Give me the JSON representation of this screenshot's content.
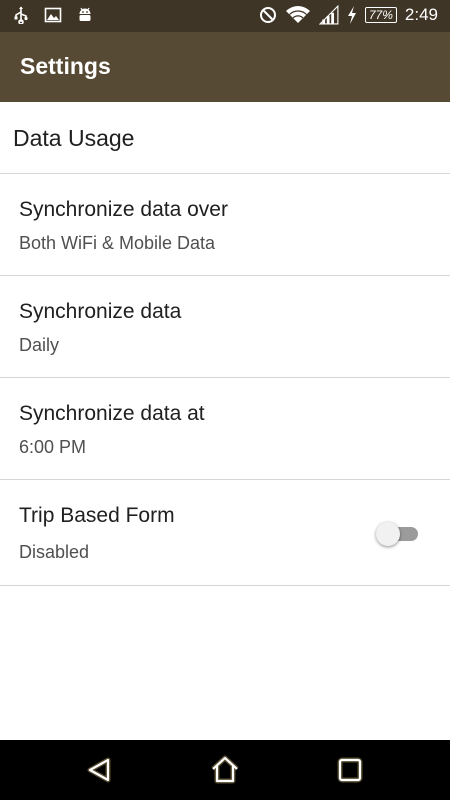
{
  "status_bar": {
    "left_icons": [
      "usb-icon",
      "image-icon",
      "android-icon"
    ],
    "right_icons": [
      "do-not-disturb-icon",
      "wifi-icon",
      "signal-icon",
      "charging-icon"
    ],
    "battery": "77%",
    "time": "2:49"
  },
  "app_bar": {
    "title": "Settings",
    "color": "#574a34"
  },
  "section": {
    "title": "Data Usage"
  },
  "preferences": [
    {
      "title": "Synchronize data over",
      "summary": "Both WiFi & Mobile Data"
    },
    {
      "title": "Synchronize data",
      "summary": "Daily"
    },
    {
      "title": "Synchronize data at",
      "summary": "6:00 PM"
    },
    {
      "title": "Trip Based Form",
      "summary": "Disabled",
      "toggle_on": false
    }
  ],
  "nav_bar": {
    "buttons": [
      "back-icon",
      "home-icon",
      "recents-icon"
    ],
    "glow_color": "#f5d98a"
  }
}
